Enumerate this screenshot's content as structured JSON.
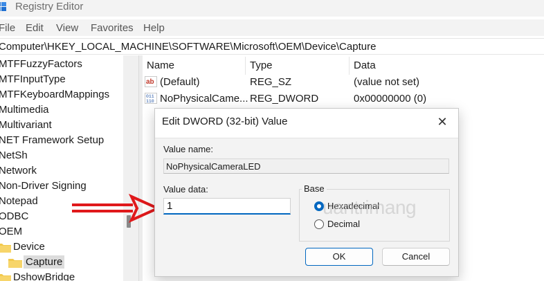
{
  "window": {
    "title": "Registry Editor"
  },
  "menu": {
    "items": [
      "File",
      "Edit",
      "View",
      "Favorites",
      "Help"
    ]
  },
  "address": {
    "path": "Computer\\HKEY_LOCAL_MACHINE\\SOFTWARE\\Microsoft\\OEM\\Device\\Capture"
  },
  "tree": {
    "items": [
      "MTFFuzzyFactors",
      "MTFInputType",
      "MTFKeyboardMappings",
      "Multimedia",
      "Multivariant",
      "NET Framework Setup",
      "NetSh",
      "Network",
      "Non-Driver Signing",
      "Notepad",
      "ODBC",
      "OEM",
      "Device",
      "Capture",
      "DshowBridge"
    ]
  },
  "list": {
    "headers": {
      "name": "Name",
      "type": "Type",
      "data": "Data"
    },
    "rows": [
      {
        "icon": "string-value-icon",
        "name": "(Default)",
        "type": "REG_SZ",
        "data": "(value not set)"
      },
      {
        "icon": "binary-value-icon",
        "name": "NoPhysicalCame...",
        "type": "REG_DWORD",
        "data": "0x00000000 (0)"
      }
    ]
  },
  "dialog": {
    "title": "Edit DWORD (32-bit) Value",
    "close": "✕",
    "value_name_label": "Value name:",
    "value_name": "NoPhysicalCameraLED",
    "value_data_label": "Value data:",
    "value_data": "1",
    "base_label": "Base",
    "base_options": [
      "Hexadecimal",
      "Decimal"
    ],
    "base_selected": "Hexadecimal",
    "ok": "OK",
    "cancel": "Cancel"
  },
  "watermark": "uantrimang",
  "colors": {
    "accent": "#0067c0",
    "arrow": "#e0191b",
    "folder": "#f2c94c"
  }
}
